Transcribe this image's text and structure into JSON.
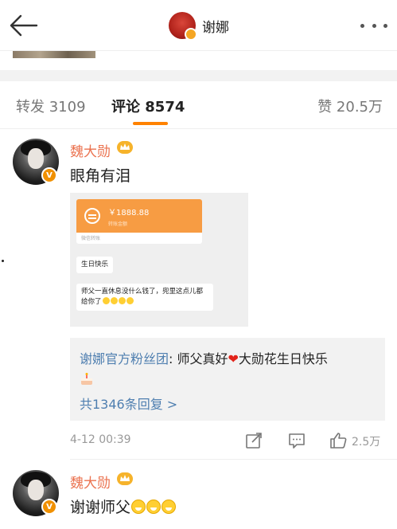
{
  "header": {
    "title": "谢娜"
  },
  "tabs": {
    "repost": "转发 3109",
    "comment": "评论 8574",
    "like": "赞 20.5万"
  },
  "comments": [
    {
      "author": "魏大勋",
      "text": "眼角有泪",
      "attachment": {
        "amount": "￥1888.88",
        "card_sub": "转账金额",
        "card_foot": "微信转账",
        "bubble1": "生日快乐",
        "bubble2": "师父一直休息没什么钱了，兜里这点儿都给你了"
      },
      "reply": {
        "author": "谢娜官方粉丝团",
        "text": "师父真好",
        "text_after": "大勋花生日快乐"
      },
      "more_replies": "共1346条回复 >",
      "time": "4-12 00:39",
      "likes": "2.5万"
    },
    {
      "author": "魏大勋",
      "text": "谢谢师父"
    }
  ],
  "colors": {
    "accent": "#ff8200",
    "username": "#eb7350",
    "link": "#4f7fb0"
  }
}
